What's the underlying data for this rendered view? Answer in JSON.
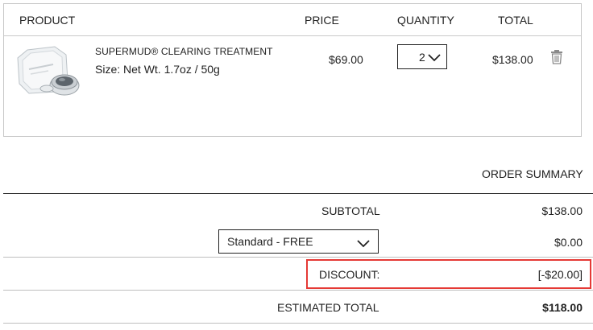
{
  "cart": {
    "headers": {
      "product": "PRODUCT",
      "price": "PRICE",
      "quantity": "QUANTITY",
      "total": "TOTAL"
    },
    "item": {
      "name": "SUPERMUD® CLEARING TREATMENT",
      "size": "Size: Net Wt. 1.7oz / 50g",
      "price": "$69.00",
      "quantity": "2",
      "total": "$138.00",
      "image_icon": "product-jar-image",
      "remove_icon": "trash-icon"
    }
  },
  "summary": {
    "title": "ORDER SUMMARY",
    "subtotal_label": "SUBTOTAL",
    "subtotal_value": "$138.00",
    "shipping_option": "Standard - FREE",
    "shipping_value": "$0.00",
    "discount_label": "DISCOUNT:",
    "discount_value": "[-$20.00]",
    "estimated_total_label": "ESTIMATED TOTAL",
    "estimated_total_value": "$118.00"
  },
  "colors": {
    "highlight": "#e53935",
    "border": "#c8c8c8",
    "text": "#222222"
  }
}
